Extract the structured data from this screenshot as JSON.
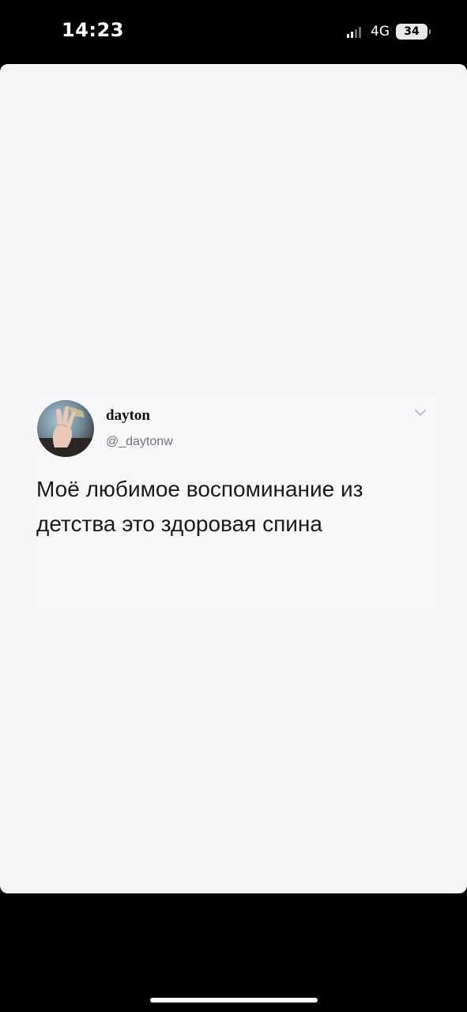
{
  "status_bar": {
    "time": "14:23",
    "network": "4G",
    "battery": "34",
    "icons": [
      "signal-icon",
      "battery-icon"
    ]
  },
  "tweet": {
    "author_name": "dayton",
    "author_handle": "@_daytonw",
    "text": "Моё любимое воспоминание из детства это здоровая спина",
    "menu_icon": "chevron-down-icon"
  },
  "colors": {
    "background": "#000000",
    "card": "#f5f5f7",
    "text": "#1a1a1a",
    "handle": "#6f7479"
  }
}
